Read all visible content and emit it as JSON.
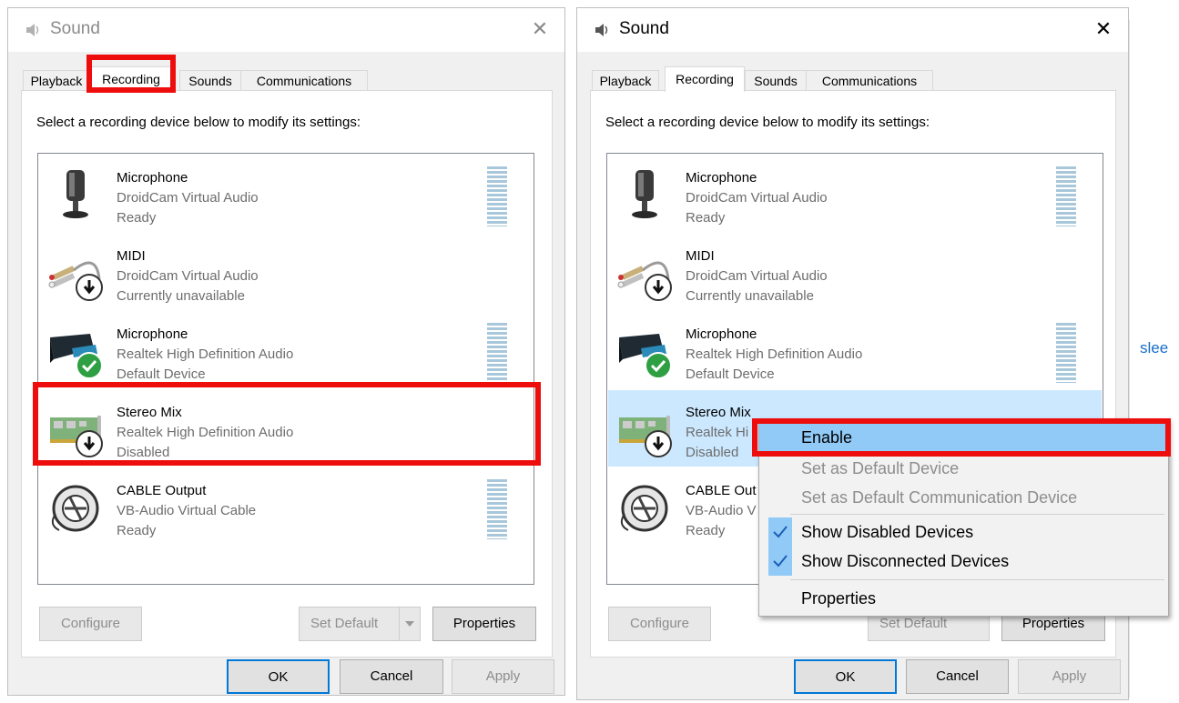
{
  "dialog": {
    "title": "Sound",
    "close_glyph": "✕",
    "tabs": [
      "Playback",
      "Recording",
      "Sounds",
      "Communications"
    ],
    "active_tab": "Recording",
    "instructions": "Select a recording device below to modify its settings:",
    "devices": [
      {
        "name": "Microphone",
        "driver": "DroidCam Virtual Audio",
        "status": "Ready",
        "icon": "microphone-icon"
      },
      {
        "name": "MIDI",
        "driver": "DroidCam Virtual Audio",
        "status": "Currently unavailable",
        "icon": "midi-cable-icon"
      },
      {
        "name": "Microphone",
        "driver": "Realtek High Definition Audio",
        "status": "Default Device",
        "icon": "webcam-microphone-icon"
      },
      {
        "name": "Stereo Mix",
        "driver": "Realtek High Definition Audio",
        "status": "Disabled",
        "icon": "sound-card-icon"
      },
      {
        "name": "CABLE Output",
        "driver": "VB-Audio Virtual Cable",
        "status": "Ready",
        "icon": "cable-reel-icon"
      }
    ],
    "buttons": {
      "configure": "Configure",
      "set_default": "Set Default",
      "properties": "Properties",
      "ok": "OK",
      "cancel": "Cancel",
      "apply": "Apply"
    }
  },
  "right_dialog_devices_truncated": {
    "stereo_mix_driver": "Realtek Hi",
    "cable_name": "CABLE Out",
    "cable_driver": "VB-Audio V"
  },
  "context_menu": {
    "items": [
      {
        "label": "Enable",
        "state": "hover"
      },
      {
        "label": "Set as Default Device",
        "state": "disabled"
      },
      {
        "label": "Set as Default Communication Device",
        "state": "disabled"
      },
      {
        "label": "Show Disabled Devices",
        "checked": true
      },
      {
        "label": "Show Disconnected Devices",
        "checked": true
      },
      {
        "label": "Properties"
      }
    ]
  },
  "background_text": "slee",
  "colors": {
    "highlight": "#ee0d0d",
    "selection": "#cce8ff",
    "menu_hover": "#91c9f7",
    "check_badge": "#2ea043"
  }
}
